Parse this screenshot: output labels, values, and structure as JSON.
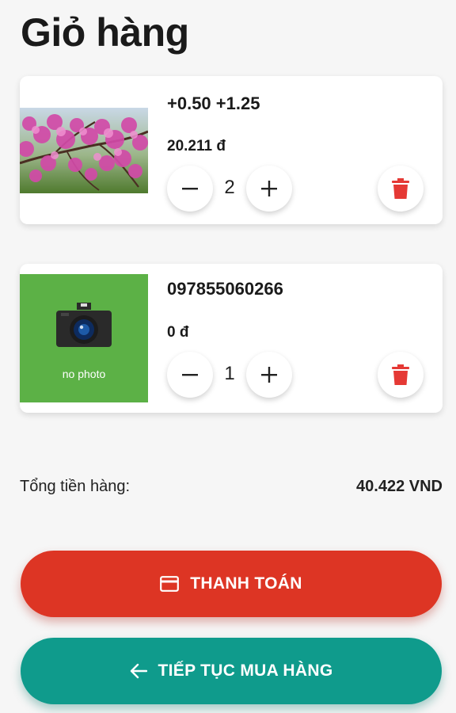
{
  "page": {
    "title": "Giỏ hàng"
  },
  "cart": {
    "items": [
      {
        "name": "+0.50 +1.25",
        "price": "20.211 đ",
        "quantity": "2",
        "image": "blossom-photo"
      },
      {
        "name": "097855060266",
        "price": "0 đ",
        "quantity": "1",
        "image": "no-photo-placeholder",
        "image_label": "no photo"
      }
    ],
    "controls": {
      "minus": "−",
      "plus": "+"
    }
  },
  "summary": {
    "total_label": "Tổng tiền hàng:",
    "total_value": "40.422 VND"
  },
  "actions": {
    "pay_label": "THANH TOÁN",
    "continue_label": "TIẾP TỤC MUA HÀNG"
  },
  "colors": {
    "pay": "#dd3524",
    "continue": "#0f9b8c",
    "delete": "#e53935",
    "placeholder": "#5cb146"
  },
  "icons": {
    "pay": "credit-card-icon",
    "continue": "arrow-left-icon",
    "delete": "trash-icon"
  }
}
